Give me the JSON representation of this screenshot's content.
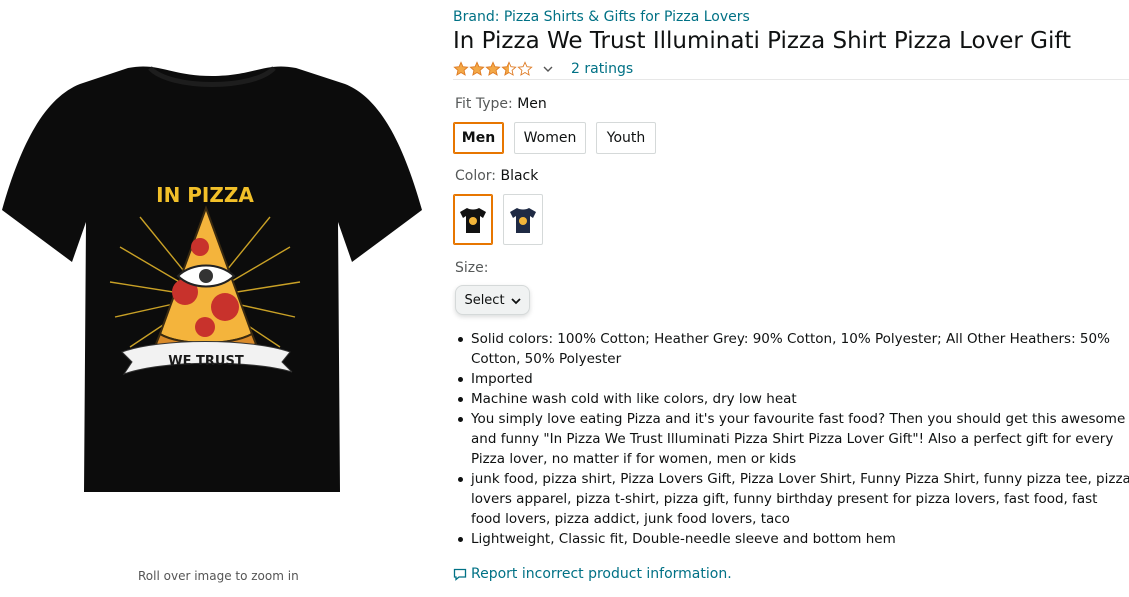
{
  "image": {
    "zoom_hint": "Roll over image to zoom in",
    "shirt_text_top": "IN PIZZA",
    "shirt_text_banner": "WE TRUST"
  },
  "product": {
    "brand": "Brand: Pizza Shirts & Gifts for Pizza Lovers",
    "title": "In Pizza We Trust Illuminati Pizza Shirt Pizza Lover Gift",
    "rating_value": 3.5,
    "rating_max": 5,
    "ratings_count": "2 ratings"
  },
  "fit": {
    "label": "Fit Type:",
    "selected": "Men",
    "options": [
      "Men",
      "Women",
      "Youth"
    ]
  },
  "color": {
    "label": "Color:",
    "selected": "Black",
    "swatches": [
      {
        "name": "Black",
        "hex": "#111111"
      },
      {
        "name": "Navy",
        "hex": "#1f2a44"
      }
    ]
  },
  "size": {
    "label": "Size:",
    "select_label": "Select"
  },
  "bullets": [
    "Solid colors: 100% Cotton; Heather Grey: 90% Cotton, 10% Polyester; All Other Heathers: 50% Cotton, 50% Polyester",
    "Imported",
    "Machine wash cold with like colors, dry low heat",
    "You simply love eating Pizza and it's your favourite fast food? Then you should get this awesome and funny \"In Pizza We Trust Illuminati Pizza Shirt Pizza Lover Gift\"! Also a perfect gift for every Pizza lover, no matter if for women, men or kids",
    "junk food, pizza shirt, Pizza Lovers Gift, Pizza Lover Shirt, Funny Pizza Shirt, funny pizza tee, pizza lovers apparel, pizza t-shirt, pizza gift, funny birthday present for pizza lovers, fast food, fast food lovers, pizza addict, junk food lovers, taco",
    "Lightweight, Classic fit, Double-needle sleeve and bottom hem"
  ],
  "report": {
    "label": "Report incorrect product information."
  },
  "colors": {
    "link": "#007185",
    "star": "#f3a847",
    "selected_border": "#e77600"
  }
}
